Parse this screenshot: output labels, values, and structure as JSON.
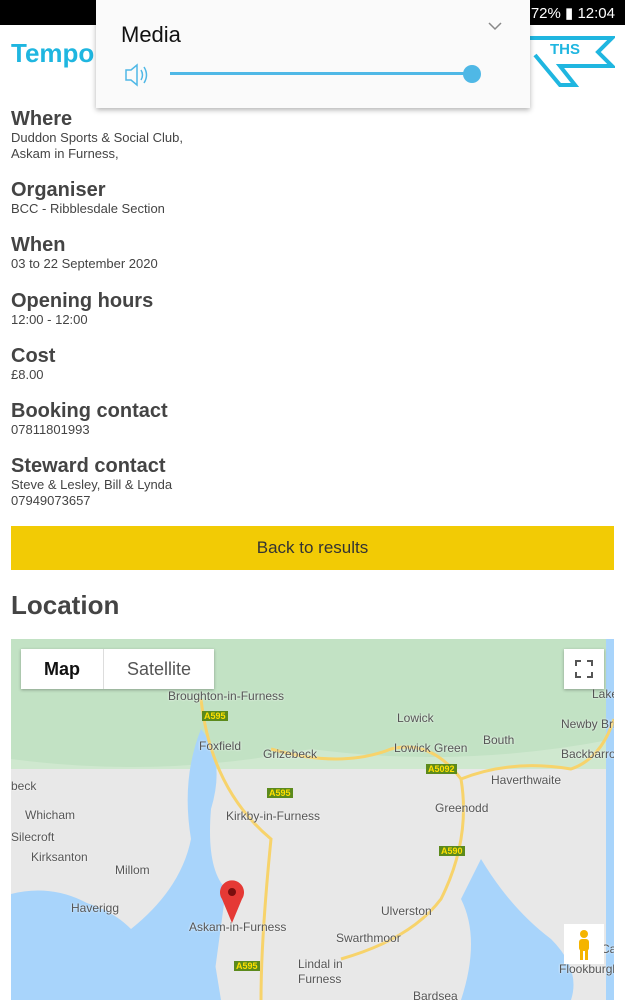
{
  "status": {
    "battery": "72%",
    "time": "12:04"
  },
  "header": {
    "title": "Tempo",
    "logo_text": "THS"
  },
  "details": [
    {
      "label": "Where",
      "lines": [
        "Duddon Sports & Social Club,",
        "Askam in Furness,"
      ]
    },
    {
      "label": "Organiser",
      "lines": [
        "BCC - Ribblesdale Section"
      ]
    },
    {
      "label": "When",
      "lines": [
        "03 to 22 September 2020"
      ]
    },
    {
      "label": "Opening hours",
      "lines": [
        "12:00 - 12:00"
      ]
    },
    {
      "label": "Cost",
      "lines": [
        "£8.00"
      ]
    },
    {
      "label": "Booking contact",
      "lines": [
        "07811801993"
      ]
    },
    {
      "label": "Steward contact",
      "lines": [
        "Steve & Lesley, Bill & Lynda",
        "07949073657"
      ]
    }
  ],
  "back_label": "Back to results",
  "location_title": "Location",
  "map": {
    "type_map": "Map",
    "type_satellite": "Satellite",
    "places": [
      "Broughton-in-Furness",
      "Lowick",
      "Newby Bri",
      "Lake",
      "Foxfield",
      "Grizebeck",
      "Lowick Green",
      "Bouth",
      "Backbarrow",
      "Haverthwaite",
      "beck",
      "Whicham",
      "Kirkby-in-Furness",
      "Greenodd",
      "Silecroft",
      "Kirksanton",
      "Millom",
      "Haverigg",
      "Askam-in-Furness",
      "Ulverston",
      "Swarthmoor",
      "Lindal in",
      "Furness",
      "Bardsea",
      "Flookburgh",
      "Ca"
    ],
    "roads": [
      "A595",
      "A5092",
      "A595",
      "A590",
      "A595"
    ]
  },
  "volume_popup": {
    "title": "Media",
    "level": 1.0,
    "accent": "#4fb8e6"
  }
}
